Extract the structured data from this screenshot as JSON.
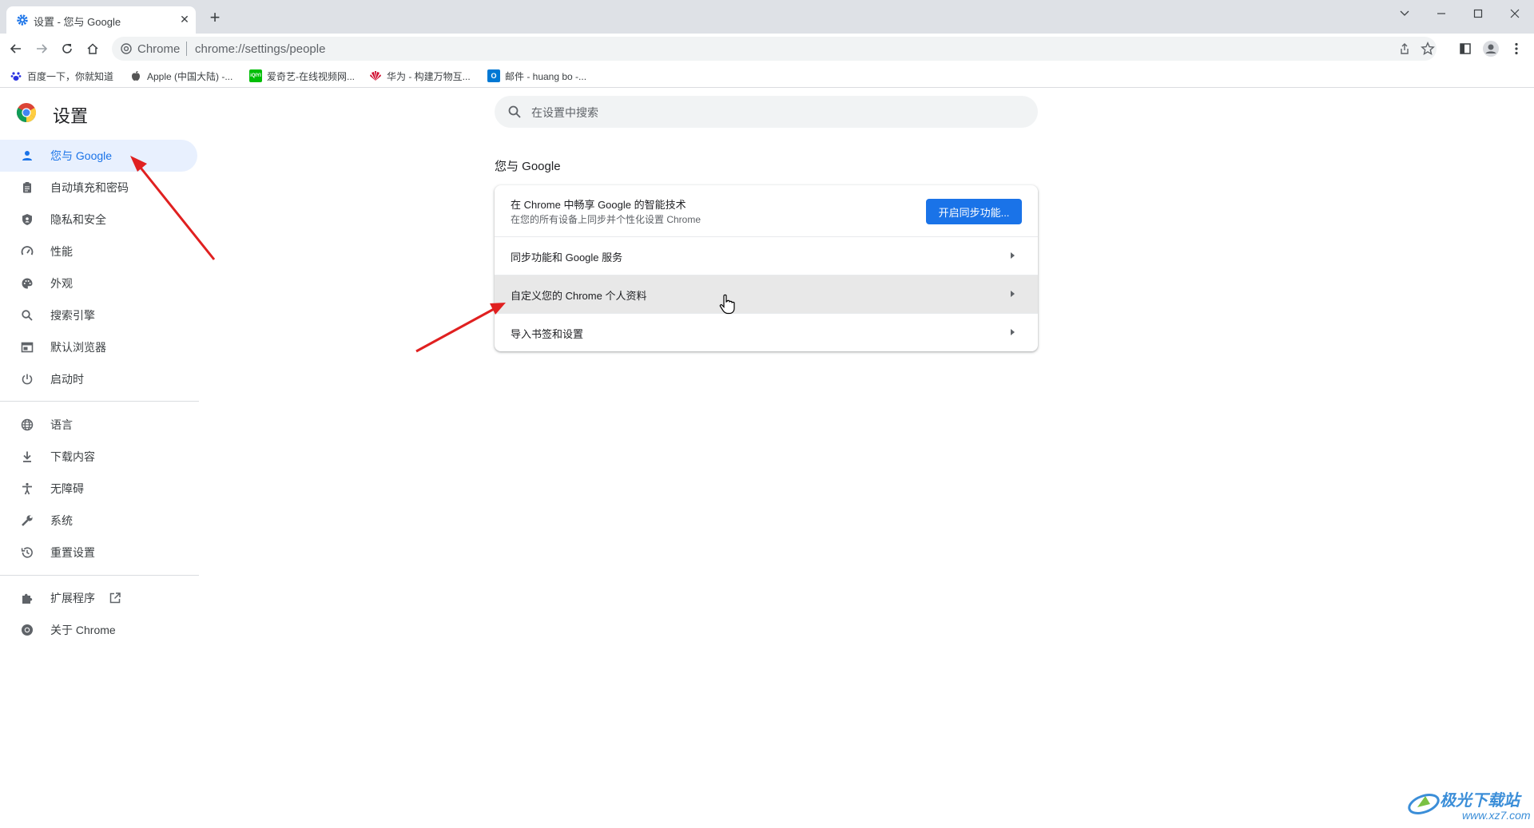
{
  "browser": {
    "tab_title": "设置 - 您与 Google",
    "tab_close": "✕",
    "new_tab": "+",
    "omnibox_site": "Chrome",
    "omnibox_url": "chrome://settings/people"
  },
  "bookmarks": [
    {
      "label": "百度一下，你就知道",
      "icon": "baidu-icon",
      "color": "#2932e1"
    },
    {
      "label": "Apple (中国大陆) -...",
      "icon": "apple-icon",
      "color": "#555555"
    },
    {
      "label": "爱奇艺-在线视频网...",
      "icon": "iqiyi-icon",
      "color": "#00be06"
    },
    {
      "label": "华为 - 构建万物互...",
      "icon": "huawei-icon",
      "color": "#cf0a2c"
    },
    {
      "label": "邮件 - huang bo -...",
      "icon": "outlook-icon",
      "color": "#0078d4"
    }
  ],
  "settings": {
    "title": "设置",
    "search_placeholder": "在设置中搜索"
  },
  "sidebar": {
    "group1": [
      {
        "label": "您与 Google",
        "icon": "person-icon",
        "active": true
      },
      {
        "label": "自动填充和密码",
        "icon": "clipboard-icon"
      },
      {
        "label": "隐私和安全",
        "icon": "shield-icon"
      },
      {
        "label": "性能",
        "icon": "speedometer-icon"
      },
      {
        "label": "外观",
        "icon": "palette-icon"
      },
      {
        "label": "搜索引擎",
        "icon": "search-icon"
      },
      {
        "label": "默认浏览器",
        "icon": "browser-window-icon"
      },
      {
        "label": "启动时",
        "icon": "power-icon"
      }
    ],
    "group2": [
      {
        "label": "语言",
        "icon": "globe-icon"
      },
      {
        "label": "下载内容",
        "icon": "download-icon"
      },
      {
        "label": "无障碍",
        "icon": "accessibility-icon"
      },
      {
        "label": "系统",
        "icon": "wrench-icon"
      },
      {
        "label": "重置设置",
        "icon": "history-icon"
      }
    ],
    "group3": [
      {
        "label": "扩展程序",
        "icon": "puzzle-icon"
      },
      {
        "label": "关于 Chrome",
        "icon": "chrome-icon"
      }
    ]
  },
  "main": {
    "section_title": "您与 Google",
    "sync_promo_title": "在 Chrome 中畅享 Google 的智能技术",
    "sync_promo_subtitle": "在您的所有设备上同步并个性化设置 Chrome",
    "sync_button": "开启同步功能...",
    "rows": [
      {
        "label": "同步功能和 Google 服务"
      },
      {
        "label": "自定义您的 Chrome 个人资料",
        "hovered": true
      },
      {
        "label": "导入书签和设置"
      }
    ]
  },
  "watermark": {
    "text": "极光下载站",
    "url": "www.xz7.com"
  },
  "colors": {
    "accent": "#1a73e8",
    "annotation_arrow": "#e02020"
  }
}
